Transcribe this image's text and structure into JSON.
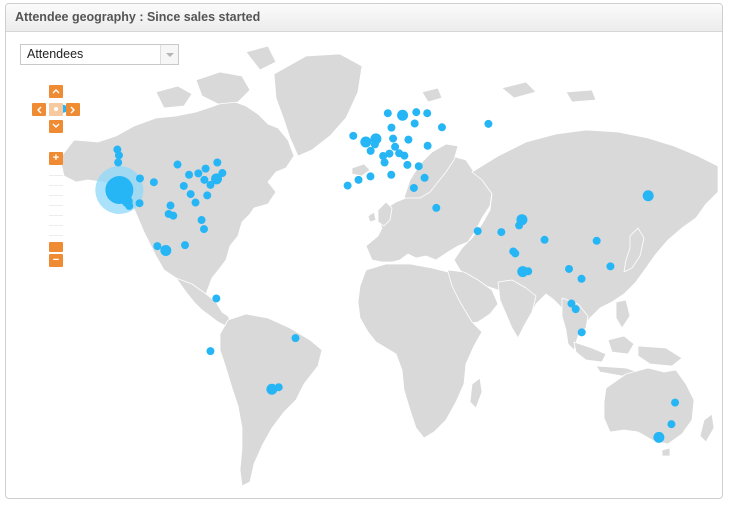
{
  "panel": {
    "title": "Attendee geography : Since sales started"
  },
  "metric_select": {
    "value": "Attendees"
  },
  "nav_controls": {
    "up_icon": "chevron-up-icon",
    "down_icon": "chevron-down-icon",
    "left_icon": "chevron-left-icon",
    "right_icon": "chevron-right-icon",
    "zoom_in_label": "+",
    "zoom_out_label": "−"
  },
  "colors": {
    "accent_controls": "#ef8b33",
    "land": "#d9d9d9",
    "marker": "#27b6f5",
    "marker_large_halo": "#8fd8fa"
  },
  "markers": [
    {
      "region": "Alaska",
      "lon": -149.9,
      "lat": 61.2,
      "size": "small"
    },
    {
      "region": "San Francisco Bay Area",
      "lon": -122.1,
      "lat": 37.4,
      "size": "large"
    },
    {
      "region": "Seattle",
      "lon": -122.3,
      "lat": 47.6,
      "size": "small"
    },
    {
      "region": "Portland",
      "lon": -122.7,
      "lat": 45.5,
      "size": "small"
    },
    {
      "region": "Los Angeles",
      "lon": -118.2,
      "lat": 34.0,
      "size": "medium"
    },
    {
      "region": "San Diego",
      "lon": -117.2,
      "lat": 32.7,
      "size": "small"
    },
    {
      "region": "Phoenix",
      "lon": -112.1,
      "lat": 33.5,
      "size": "small"
    },
    {
      "region": "Salt Lake City",
      "lon": -111.9,
      "lat": 40.8,
      "size": "small"
    },
    {
      "region": "Denver",
      "lon": -105.0,
      "lat": 39.7,
      "size": "small"
    },
    {
      "region": "Austin",
      "lon": -97.7,
      "lat": 30.3,
      "size": "small"
    },
    {
      "region": "Dallas",
      "lon": -96.8,
      "lat": 32.8,
      "size": "small"
    },
    {
      "region": "Houston",
      "lon": -95.4,
      "lat": 29.8,
      "size": "small"
    },
    {
      "region": "Minneapolis",
      "lon": -93.3,
      "lat": 44.9,
      "size": "small"
    },
    {
      "region": "Chicago",
      "lon": -87.6,
      "lat": 41.9,
      "size": "small"
    },
    {
      "region": "St. Louis",
      "lon": -90.2,
      "lat": 38.6,
      "size": "small"
    },
    {
      "region": "Nashville",
      "lon": -86.8,
      "lat": 36.2,
      "size": "small"
    },
    {
      "region": "Atlanta",
      "lon": -84.4,
      "lat": 33.7,
      "size": "small"
    },
    {
      "region": "Detroit",
      "lon": -83.0,
      "lat": 42.3,
      "size": "small"
    },
    {
      "region": "Toronto",
      "lon": -79.4,
      "lat": 43.7,
      "size": "small"
    },
    {
      "region": "Pittsburgh",
      "lon": -80.0,
      "lat": 40.4,
      "size": "small"
    },
    {
      "region": "Washington DC",
      "lon": -77.0,
      "lat": 38.9,
      "size": "small"
    },
    {
      "region": "New York",
      "lon": -74.0,
      "lat": 40.7,
      "size": "medium"
    },
    {
      "region": "Boston",
      "lon": -71.1,
      "lat": 42.4,
      "size": "small"
    },
    {
      "region": "Raleigh",
      "lon": -78.6,
      "lat": 35.8,
      "size": "small"
    },
    {
      "region": "Miami",
      "lon": -80.2,
      "lat": 25.8,
      "size": "small"
    },
    {
      "region": "Orlando",
      "lon": -81.4,
      "lat": 28.5,
      "size": "small"
    },
    {
      "region": "Montreal",
      "lon": -73.6,
      "lat": 45.5,
      "size": "small"
    },
    {
      "region": "Vancouver",
      "lon": -123.1,
      "lat": 49.3,
      "size": "small"
    },
    {
      "region": "Mexico City",
      "lon": -99.1,
      "lat": 19.4,
      "size": "medium"
    },
    {
      "region": "Guadalajara",
      "lon": -103.3,
      "lat": 20.7,
      "size": "small"
    },
    {
      "region": "Merida",
      "lon": -89.6,
      "lat": 21.0,
      "size": "small"
    },
    {
      "region": "Bogota",
      "lon": -74.1,
      "lat": 4.7,
      "size": "small"
    },
    {
      "region": "Lima",
      "lon": -77.0,
      "lat": -12.0,
      "size": "small"
    },
    {
      "region": "Recife",
      "lon": -34.9,
      "lat": -8.0,
      "size": "small"
    },
    {
      "region": "Rio de Janeiro",
      "lon": -43.2,
      "lat": -22.9,
      "size": "small"
    },
    {
      "region": "Sao Paulo",
      "lon": -46.6,
      "lat": -23.5,
      "size": "medium"
    },
    {
      "region": "Lisbon",
      "lon": -9.1,
      "lat": 38.7,
      "size": "small"
    },
    {
      "region": "Madrid",
      "lon": -3.7,
      "lat": 40.4,
      "size": "small"
    },
    {
      "region": "Barcelona",
      "lon": 2.2,
      "lat": 41.4,
      "size": "small"
    },
    {
      "region": "Dublin",
      "lon": -6.3,
      "lat": 53.3,
      "size": "small"
    },
    {
      "region": "London",
      "lon": -0.1,
      "lat": 51.5,
      "size": "medium"
    },
    {
      "region": "Paris",
      "lon": 2.3,
      "lat": 48.9,
      "size": "small"
    },
    {
      "region": "Amsterdam",
      "lon": 4.9,
      "lat": 52.4,
      "size": "medium"
    },
    {
      "region": "Brussels",
      "lon": 4.4,
      "lat": 50.8,
      "size": "small"
    },
    {
      "region": "Zurich",
      "lon": 8.5,
      "lat": 47.4,
      "size": "small"
    },
    {
      "region": "Milan",
      "lon": 9.2,
      "lat": 45.5,
      "size": "small"
    },
    {
      "region": "Rome",
      "lon": 12.5,
      "lat": 41.9,
      "size": "small"
    },
    {
      "region": "Berlin",
      "lon": 13.4,
      "lat": 52.5,
      "size": "small"
    },
    {
      "region": "Munich",
      "lon": 11.6,
      "lat": 48.1,
      "size": "small"
    },
    {
      "region": "Vienna",
      "lon": 16.4,
      "lat": 48.2,
      "size": "small"
    },
    {
      "region": "Prague",
      "lon": 14.4,
      "lat": 50.1,
      "size": "small"
    },
    {
      "region": "Warsaw",
      "lon": 21.0,
      "lat": 52.2,
      "size": "small"
    },
    {
      "region": "Budapest",
      "lon": 19.0,
      "lat": 47.5,
      "size": "small"
    },
    {
      "region": "Belgrade",
      "lon": 20.5,
      "lat": 44.8,
      "size": "small"
    },
    {
      "region": "Bucharest",
      "lon": 26.1,
      "lat": 44.4,
      "size": "small"
    },
    {
      "region": "Kyiv",
      "lon": 30.5,
      "lat": 50.4,
      "size": "small"
    },
    {
      "region": "Athens",
      "lon": 23.7,
      "lat": 38.0,
      "size": "small"
    },
    {
      "region": "Istanbul",
      "lon": 29.0,
      "lat": 41.0,
      "size": "small"
    },
    {
      "region": "Oslo",
      "lon": 10.8,
      "lat": 59.9,
      "size": "small"
    },
    {
      "region": "Stockholm",
      "lon": 18.1,
      "lat": 59.3,
      "size": "medium"
    },
    {
      "region": "Copenhagen",
      "lon": 12.6,
      "lat": 55.7,
      "size": "small"
    },
    {
      "region": "Helsinki",
      "lon": 24.9,
      "lat": 60.2,
      "size": "small"
    },
    {
      "region": "Saint Petersburg",
      "lon": 30.3,
      "lat": 59.9,
      "size": "small"
    },
    {
      "region": "Riga",
      "lon": 24.1,
      "lat": 56.9,
      "size": "small"
    },
    {
      "region": "Moscow",
      "lon": 37.6,
      "lat": 55.8,
      "size": "small"
    },
    {
      "region": "Yekaterinburg",
      "lon": 60.6,
      "lat": 56.8,
      "size": "small"
    },
    {
      "region": "Tel Aviv",
      "lon": 34.8,
      "lat": 32.1,
      "size": "small"
    },
    {
      "region": "Dubai",
      "lon": 55.3,
      "lat": 25.2,
      "size": "small"
    },
    {
      "region": "Karachi",
      "lon": 67.0,
      "lat": 24.9,
      "size": "small"
    },
    {
      "region": "Delhi",
      "lon": 77.2,
      "lat": 28.6,
      "size": "medium"
    },
    {
      "region": "Jaipur",
      "lon": 75.8,
      "lat": 26.9,
      "size": "small"
    },
    {
      "region": "Mumbai",
      "lon": 72.9,
      "lat": 19.1,
      "size": "small"
    },
    {
      "region": "Pune",
      "lon": 73.9,
      "lat": 18.5,
      "size": "small"
    },
    {
      "region": "Bangalore",
      "lon": 77.6,
      "lat": 13.0,
      "size": "medium"
    },
    {
      "region": "Chennai",
      "lon": 80.3,
      "lat": 13.1,
      "size": "small"
    },
    {
      "region": "Kolkata",
      "lon": 88.4,
      "lat": 22.6,
      "size": "small"
    },
    {
      "region": "Bangkok",
      "lon": 100.5,
      "lat": 13.8,
      "size": "small"
    },
    {
      "region": "Ho Chi Minh City",
      "lon": 106.7,
      "lat": 10.8,
      "size": "small"
    },
    {
      "region": "Hong Kong",
      "lon": 114.2,
      "lat": 22.3,
      "size": "small"
    },
    {
      "region": "Manila",
      "lon": 121.0,
      "lat": 14.6,
      "size": "small"
    },
    {
      "region": "Kuala Lumpur",
      "lon": 101.7,
      "lat": 3.1,
      "size": "small"
    },
    {
      "region": "Singapore",
      "lon": 103.8,
      "lat": 1.3,
      "size": "small"
    },
    {
      "region": "Jakarta",
      "lon": 106.8,
      "lat": -6.2,
      "size": "small"
    },
    {
      "region": "Tokyo",
      "lon": 139.7,
      "lat": 35.7,
      "size": "medium"
    },
    {
      "region": "Brisbane",
      "lon": 153.0,
      "lat": -27.5,
      "size": "small"
    },
    {
      "region": "Sydney",
      "lon": 151.2,
      "lat": -33.9,
      "size": "small"
    },
    {
      "region": "Melbourne",
      "lon": 145.0,
      "lat": -37.8,
      "size": "medium"
    }
  ]
}
